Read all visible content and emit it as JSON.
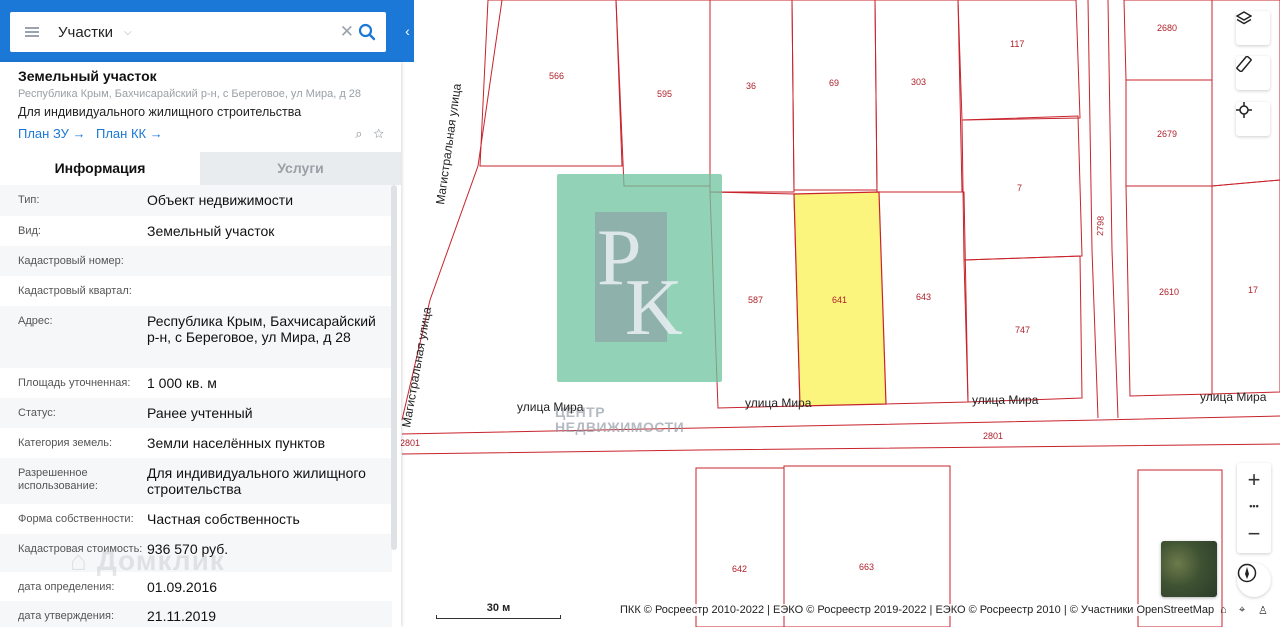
{
  "search": {
    "label": "Участки"
  },
  "object": {
    "title": "Земельный участок",
    "address": "Республика Крым, Бахчисарайский р-н, с Береговое, ул Мира, д 28",
    "use": "Для индивидуального жилищного строительства",
    "plan_zu": "План ЗУ",
    "plan_kk": "План КК"
  },
  "tabs": {
    "info": "Информация",
    "services": "Услуги"
  },
  "info_rows": [
    {
      "label": "Тип:",
      "value": "Объект недвижимости"
    },
    {
      "label": "Вид:",
      "value": "Земельный участок"
    },
    {
      "label": "Кадастровый номер:",
      "value": ""
    },
    {
      "label": "Кадастровый квартал:",
      "value": ""
    },
    {
      "label": "Адрес:",
      "value": "Республика Крым, Бахчисарайский р-н, с Береговое, ул Мира, д 28"
    },
    {
      "label": "Площадь уточненная:",
      "value": "1 000 кв. м"
    },
    {
      "label": "Статус:",
      "value": "Ранее учтенный"
    },
    {
      "label": "Категория земель:",
      "value": "Земли населённых пунктов"
    },
    {
      "label": "Разрешенное использование:",
      "value": "Для индивидуального жилищного строительства"
    },
    {
      "label": "Форма собственности:",
      "value": "Частная собственность"
    },
    {
      "label": "Кадастровая стоимость:",
      "value": "936 570 руб."
    },
    {
      "label": "дата определения:",
      "value": "01.09.2016"
    },
    {
      "label": "дата утверждения:",
      "value": "21.11.2019"
    }
  ],
  "watermark": "Домклик",
  "map": {
    "parcels": [
      "566",
      "595",
      "36",
      "69",
      "303",
      "117",
      "2680",
      "2679",
      "7",
      "2798",
      "587",
      "641",
      "643",
      "747",
      "2610",
      "17",
      "642",
      "663"
    ],
    "streets": {
      "magistral_1": "Магистральная улица",
      "magistral_2": "Магистральная улица",
      "mira_1": "улица Мира",
      "mira_2": "улица Мира",
      "mira_3": "улица Мира",
      "mira_4": "улица Мира"
    },
    "roads": [
      "2801",
      "2801"
    ],
    "logo_line1": "ЦЕНТР",
    "logo_line2": "НЕДВИЖИМОСТИ",
    "highlight_color": "#fbf57e",
    "line_color": "#c8232c"
  },
  "controls": {
    "zoom_in": "+",
    "zoom_more": "•••",
    "zoom_out": "−"
  },
  "scale_label": "30 м",
  "attribution": "ПКК © Росреестр 2010-2022 | ЕЭКО © Росреестр 2019-2022 | ЕЭКО © Росреестр 2010 | © Участники OpenStreetMap",
  "colors": {
    "accent": "#1b78d6"
  }
}
